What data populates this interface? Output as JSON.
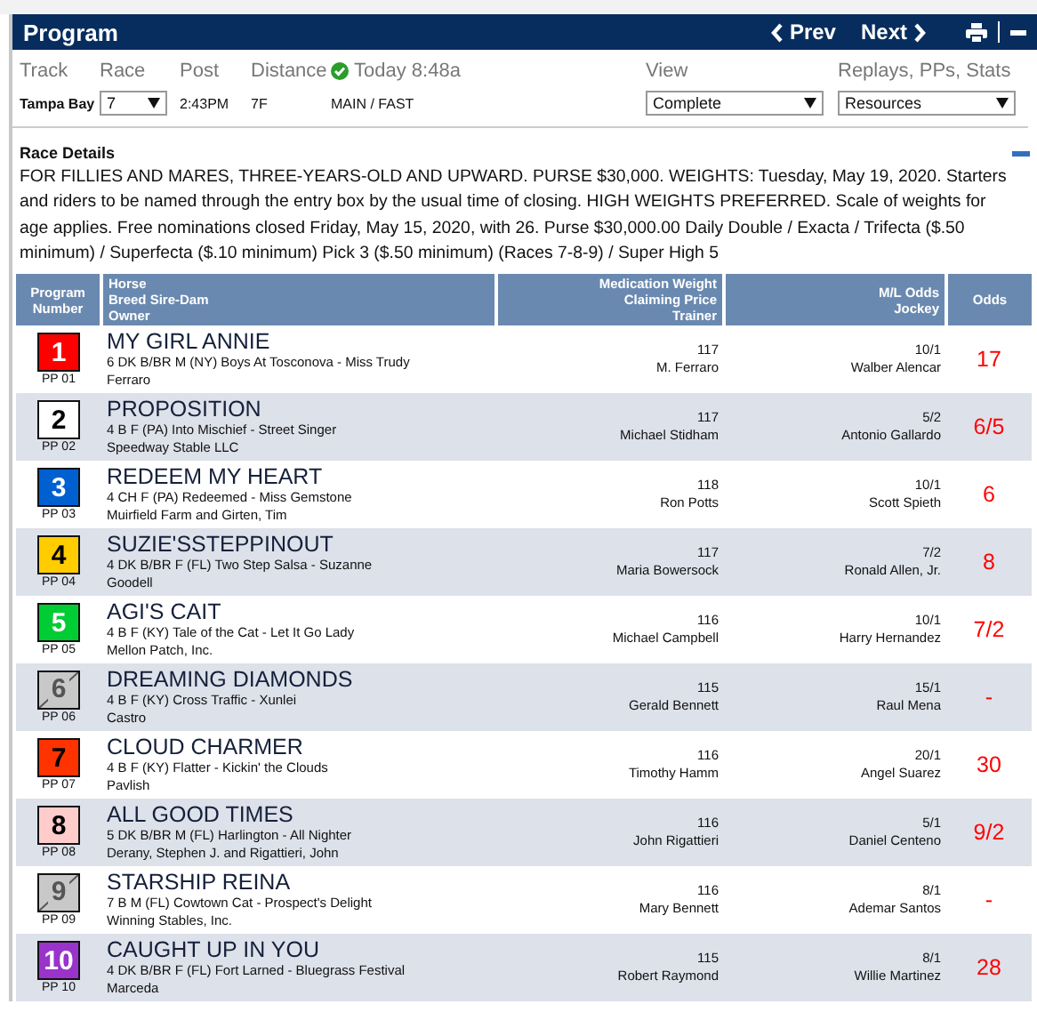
{
  "header": {
    "title": "Program",
    "prev": "Prev",
    "next": "Next"
  },
  "info": {
    "labels": [
      "Track",
      "Race",
      "Post",
      "Distance"
    ],
    "status": "Today 8:48a",
    "track": "Tampa Bay",
    "race": "7",
    "post": "2:43PM",
    "distance": "7F",
    "surface": "MAIN / FAST",
    "view_label": "View",
    "view": "Complete",
    "resources_label": "Replays, PPs, Stats",
    "resources": "Resources"
  },
  "details": {
    "title": "Race Details",
    "text": "FOR FILLIES AND MARES, THREE-YEARS-OLD AND UPWARD. PURSE $30,000. WEIGHTS: Tuesday, May 19, 2020. Starters and riders to be named through the entry box by the usual time of closing. HIGH WEIGHTS PREFERRED. Scale of weights for age applies. Free nominations closed Friday, May 15, 2020, with 26. Purse $30,000.00 Daily Double / Exacta / Trifecta ($.50 minimum) / Superfecta ($.10 minimum) Pick 3 ($.50 minimum) (Races 7-8-9) / Super High 5"
  },
  "columns": [
    [
      "Program",
      "Number"
    ],
    [
      "Horse",
      "Breed Sire-Dam",
      "Owner"
    ],
    [
      "Medication Weight",
      "Claiming Price",
      "Trainer"
    ],
    [
      "M/L Odds",
      "Jockey"
    ],
    [
      "Odds"
    ]
  ],
  "entries": [
    {
      "number": "1",
      "pp": "PP 01",
      "color": "#ff0000",
      "scratched": false,
      "name": "MY GIRL ANNIE",
      "breed": "6 DK B/BR M (NY) Boys At Tosconova - Miss Trudy",
      "owner": "Ferraro",
      "weight": "117",
      "trainer": "M. Ferraro",
      "ml": "10/1",
      "jockey": "Walber Alencar",
      "odds": "17"
    },
    {
      "number": "2",
      "pp": "PP 02",
      "color": "#ffffff",
      "scratched": false,
      "name": "PROPOSITION",
      "breed": "4 B F (PA) Into Mischief - Street Singer",
      "owner": "Speedway Stable LLC",
      "weight": "117",
      "trainer": "Michael Stidham",
      "ml": "5/2",
      "jockey": "Antonio Gallardo",
      "odds": "6/5"
    },
    {
      "number": "3",
      "pp": "PP 03",
      "color": "#0060d0",
      "scratched": false,
      "name": "REDEEM MY HEART",
      "breed": "4 CH F (PA) Redeemed - Miss Gemstone",
      "owner": "Muirfield Farm and Girten, Tim",
      "weight": "118",
      "trainer": "Ron Potts",
      "ml": "10/1",
      "jockey": "Scott Spieth",
      "odds": "6"
    },
    {
      "number": "4",
      "pp": "PP 04",
      "color": "#ffcc00",
      "scratched": false,
      "name": "SUZIE'SSTEPPINOUT",
      "breed": "4 DK B/BR F (FL) Two Step Salsa - Suzanne",
      "owner": "Goodell",
      "weight": "117",
      "trainer": "Maria Bowersock",
      "ml": "7/2",
      "jockey": "Ronald Allen, Jr.",
      "odds": "8"
    },
    {
      "number": "5",
      "pp": "PP 05",
      "color": "#00cc33",
      "scratched": false,
      "name": "AGI'S CAIT",
      "breed": "4 B F (KY) Tale of the Cat - Let It Go Lady",
      "owner": "Mellon Patch, Inc.",
      "weight": "116",
      "trainer": "Michael Campbell",
      "ml": "10/1",
      "jockey": "Harry Hernandez",
      "odds": "7/2"
    },
    {
      "number": "6",
      "pp": "PP 06",
      "color": "#c8c8c8",
      "scratched": true,
      "name": "DREAMING DIAMONDS",
      "breed": "4 B F (KY) Cross Traffic - Xunlei",
      "owner": "Castro",
      "weight": "115",
      "trainer": "Gerald Bennett",
      "ml": "15/1",
      "jockey": "Raul Mena",
      "odds": "-"
    },
    {
      "number": "7",
      "pp": "PP 07",
      "color": "#ff3300",
      "scratched": false,
      "name": "CLOUD CHARMER",
      "breed": "4 B F (KY) Flatter - Kickin' the Clouds",
      "owner": "Pavlish",
      "weight": "116",
      "trainer": "Timothy Hamm",
      "ml": "20/1",
      "jockey": "Angel Suarez",
      "odds": "30"
    },
    {
      "number": "8",
      "pp": "PP 08",
      "color": "#ffcccc",
      "scratched": false,
      "name": "ALL GOOD TIMES",
      "breed": "5 DK B/BR M (FL) Harlington - All Nighter",
      "owner": "Derany, Stephen J. and Rigattieri, John",
      "weight": "116",
      "trainer": "John Rigattieri",
      "ml": "5/1",
      "jockey": "Daniel Centeno",
      "odds": "9/2"
    },
    {
      "number": "9",
      "pp": "PP 09",
      "color": "#c8c8c8",
      "scratched": true,
      "name": "STARSHIP REINA",
      "breed": "7 B M (FL) Cowtown Cat - Prospect's Delight",
      "owner": "Winning Stables, Inc.",
      "weight": "116",
      "trainer": "Mary Bennett",
      "ml": "8/1",
      "jockey": "Ademar Santos",
      "odds": "-"
    },
    {
      "number": "10",
      "pp": "PP 10",
      "color": "#9933cc",
      "scratched": false,
      "name": "CAUGHT UP IN YOU",
      "breed": "4 DK B/BR F (FL) Fort Larned - Bluegrass Festival",
      "owner": "Marceda",
      "weight": "115",
      "trainer": "Robert Raymond",
      "ml": "8/1",
      "jockey": "Willie Martinez",
      "odds": "28"
    }
  ]
}
